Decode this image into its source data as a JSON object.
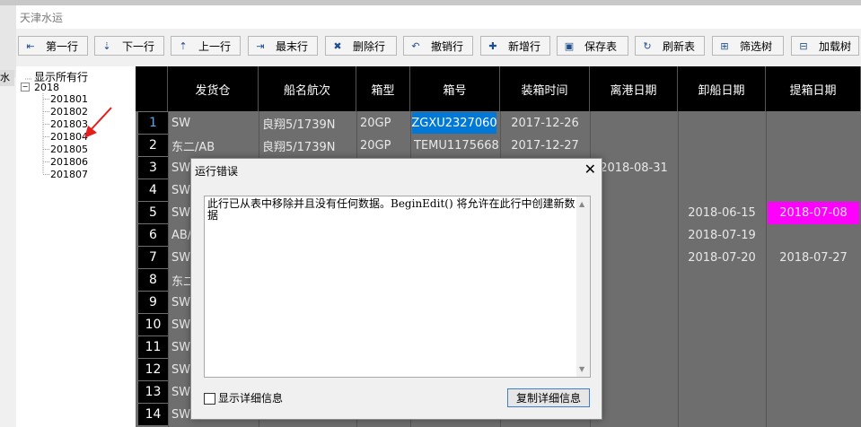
{
  "window": {
    "title": "天津水运"
  },
  "toolbar": {
    "buttons": [
      {
        "label": "第一行",
        "icon": "first-row-icon",
        "glyph": "⇤"
      },
      {
        "label": "下一行",
        "icon": "next-row-icon",
        "glyph": "⇣"
      },
      {
        "label": "上一行",
        "icon": "prev-row-icon",
        "glyph": "⇡"
      },
      {
        "label": "最末行",
        "icon": "last-row-icon",
        "glyph": "⇥"
      },
      {
        "label": "删除行",
        "icon": "delete-row-icon",
        "glyph": "✖"
      },
      {
        "label": "撤销行",
        "icon": "undo-row-icon",
        "glyph": "↶"
      },
      {
        "label": "新增行",
        "icon": "add-row-icon",
        "glyph": "✚"
      },
      {
        "label": "保存表",
        "icon": "save-icon",
        "glyph": "▣"
      },
      {
        "label": "刷新表",
        "icon": "refresh-icon",
        "glyph": "↻"
      },
      {
        "label": "筛选树",
        "icon": "filter-tree-icon",
        "glyph": "⊞"
      },
      {
        "label": "加载树",
        "icon": "load-tree-icon",
        "glyph": "⊟"
      }
    ]
  },
  "sidebar": {
    "edge_tab": "水",
    "root": "显示所有行",
    "year": "2018",
    "months": [
      "201801",
      "201802",
      "201803",
      "201804",
      "201805",
      "201806",
      "201807"
    ]
  },
  "grid": {
    "columns": [
      "发货仓",
      "船名航次",
      "箱型",
      "箱号",
      "装箱时间",
      "离港日期",
      "卸船日期",
      "提箱日期"
    ],
    "row_numbers": [
      "1",
      "2",
      "3",
      "4",
      "5",
      "6",
      "7",
      "8",
      "9",
      "10",
      "11",
      "12",
      "13",
      "14"
    ],
    "rows": [
      {
        "c0": "SW",
        "c1": "良翔5/1739N",
        "c2": "20GP",
        "c3": "ZGXU2327060",
        "c4": "2017-12-26",
        "c5": "",
        "c6": "",
        "c7": ""
      },
      {
        "c0": "东二/AB",
        "c1": "良翔5/1739N",
        "c2": "20GP",
        "c3": "TEMU1175668",
        "c4": "2017-12-27",
        "c5": "",
        "c6": "",
        "c7": ""
      },
      {
        "c0": "SW",
        "c1": "",
        "c2": "",
        "c3": "",
        "c4": "",
        "c5": "2018-08-31",
        "c6": "",
        "c7": ""
      },
      {
        "c0": "SW",
        "c1": "",
        "c2": "",
        "c3": "",
        "c4": "",
        "c5": "",
        "c6": "",
        "c7": ""
      },
      {
        "c0": "SW",
        "c1": "",
        "c2": "",
        "c3": "",
        "c4": "",
        "c5": "",
        "c6": "2018-06-15",
        "c7": "2018-07-08"
      },
      {
        "c0": "AB/",
        "c1": "",
        "c2": "",
        "c3": "",
        "c4": "",
        "c5": "",
        "c6": "2018-07-19",
        "c7": ""
      },
      {
        "c0": "SW",
        "c1": "",
        "c2": "",
        "c3": "",
        "c4": "",
        "c5": "",
        "c6": "2018-07-20",
        "c7": "2018-07-27"
      },
      {
        "c0": "东二",
        "c1": "",
        "c2": "",
        "c3": "",
        "c4": "",
        "c5": "",
        "c6": "",
        "c7": ""
      },
      {
        "c0": "SW",
        "c1": "",
        "c2": "",
        "c3": "",
        "c4": "",
        "c5": "",
        "c6": "",
        "c7": ""
      },
      {
        "c0": "SW",
        "c1": "",
        "c2": "",
        "c3": "",
        "c4": "",
        "c5": "",
        "c6": "",
        "c7": ""
      },
      {
        "c0": "SW",
        "c1": "",
        "c2": "",
        "c3": "",
        "c4": "",
        "c5": "",
        "c6": "",
        "c7": ""
      },
      {
        "c0": "SW",
        "c1": "",
        "c2": "",
        "c3": "",
        "c4": "",
        "c5": "",
        "c6": "",
        "c7": ""
      },
      {
        "c0": "SW",
        "c1": "",
        "c2": "",
        "c3": "",
        "c4": "",
        "c5": "",
        "c6": "",
        "c7": ""
      },
      {
        "c0": "SW",
        "c1": "",
        "c2": "",
        "c3": "",
        "c4": "",
        "c5": "",
        "c6": "",
        "c7": ""
      }
    ],
    "selected_cell_color": "#0078d7",
    "highlight_cell_color": "#ff00ff"
  },
  "dialog": {
    "title": "运行错误",
    "message": "此行已从表中移除并且没有任何数据。BeginEdit() 将允许在此行中创建新数据",
    "checkbox_label": "显示详细信息",
    "copy_button": "复制详细信息",
    "close_glyph": "✕"
  }
}
